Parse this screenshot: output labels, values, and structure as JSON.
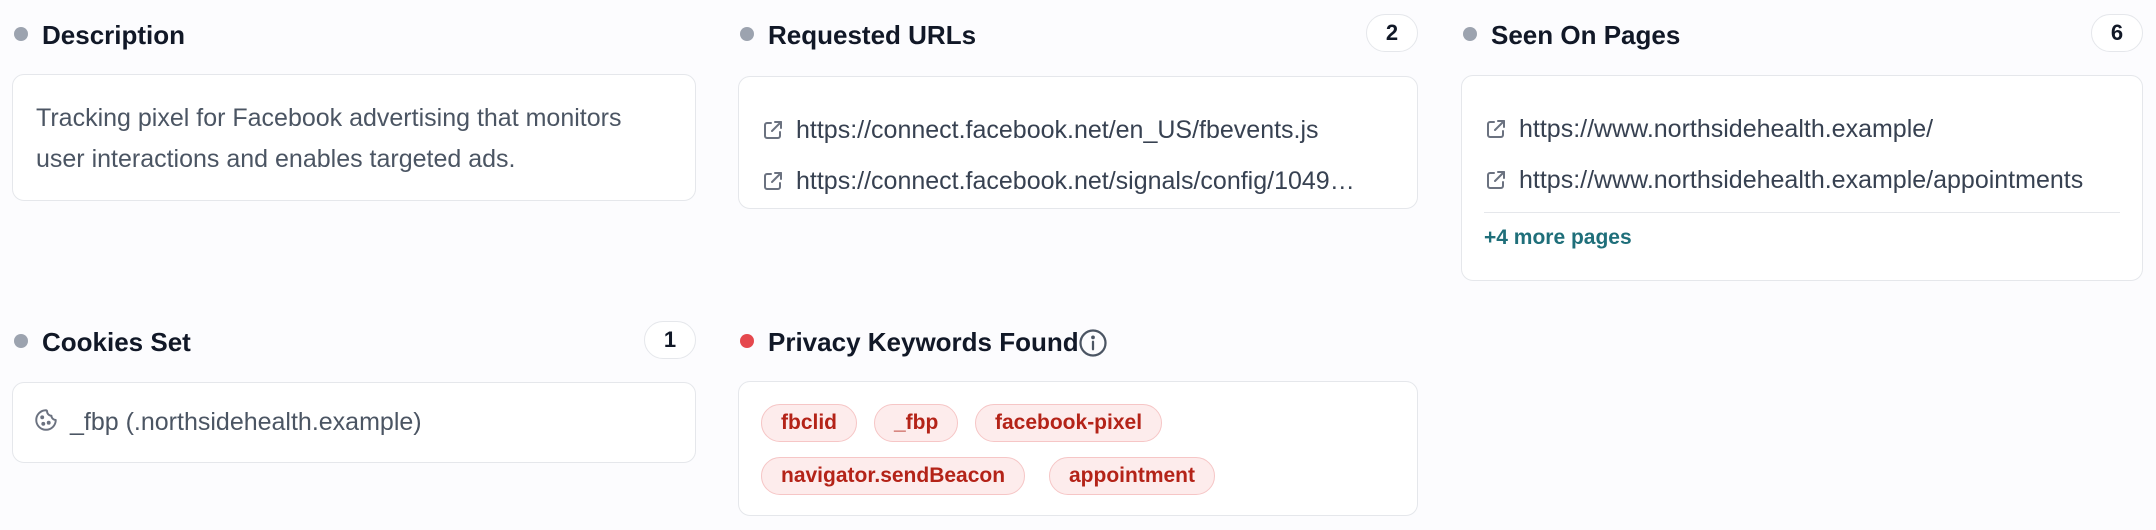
{
  "description": {
    "title": "Description",
    "text": "Tracking pixel for Facebook advertising that monitors user interactions and enables targeted ads."
  },
  "requested_urls": {
    "title": "Requested URLs",
    "count": "2",
    "items": [
      "https://connect.facebook.net/en_US/fbevents.js",
      "https://connect.facebook.net/signals/config/1049…"
    ]
  },
  "seen_on_pages": {
    "title": "Seen On Pages",
    "count": "6",
    "items": [
      "https://www.northsidehealth.example/",
      "https://www.northsidehealth.example/appointments"
    ],
    "more_label": "+4 more pages"
  },
  "cookies_set": {
    "title": "Cookies Set",
    "count": "1",
    "items": [
      "_fbp (.northsidehealth.example)"
    ]
  },
  "privacy_keywords": {
    "title": "Privacy Keywords Found",
    "keywords": [
      "fbclid",
      "_fbp",
      "facebook-pixel",
      "navigator.sendBeacon",
      "appointment"
    ]
  },
  "colors": {
    "neutral_dot": "#9ca3af",
    "alert_dot": "#e5484d",
    "keyword_text": "#b42318",
    "keyword_bg": "#fdecec",
    "link": "#1f6f7a"
  },
  "icons": {
    "external_link": "external-link-icon",
    "cookie": "cookie-icon",
    "info": "info-icon"
  }
}
